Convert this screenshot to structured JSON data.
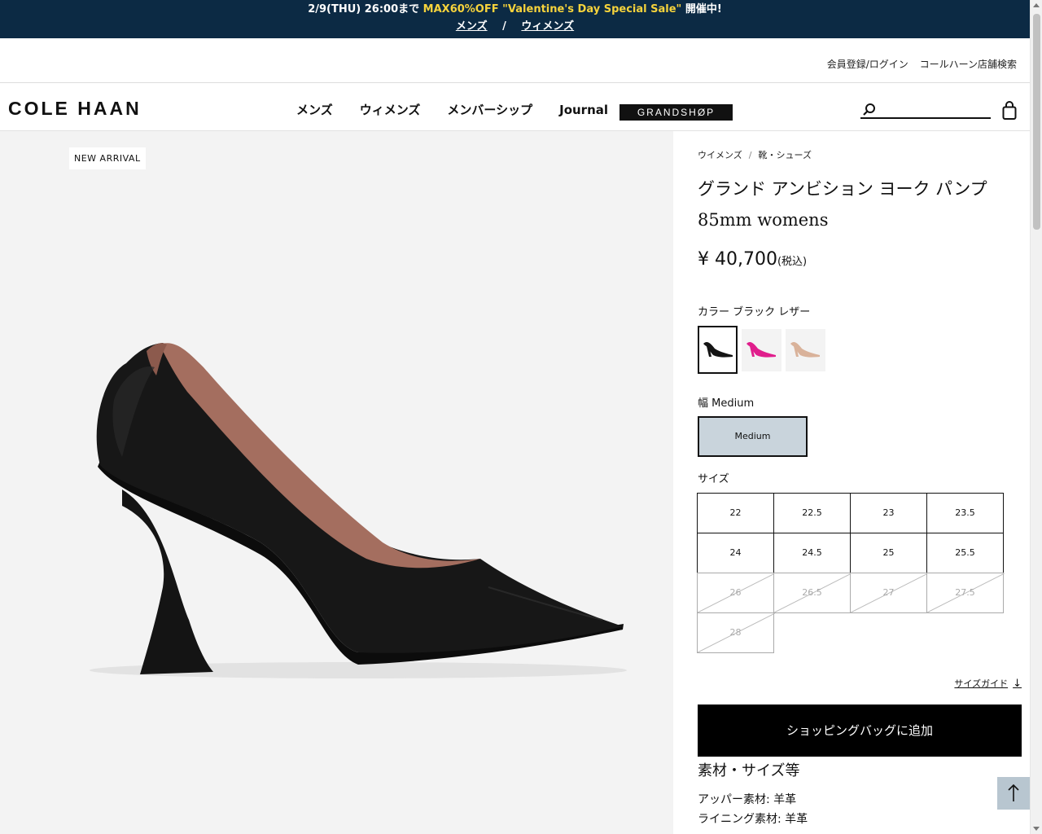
{
  "promo": {
    "prefix": "2/9(THU) 26:00まで ",
    "highlight": "MAX60%OFF \"Valentine's Day Special Sale\"",
    "suffix": " 開催中!",
    "links": [
      "メンズ",
      "ウィメンズ"
    ],
    "separator": "/"
  },
  "utility": {
    "login": "会員登録/ログイン",
    "store": "コールハーン店舗検索"
  },
  "header": {
    "logo": "COLE HAAN",
    "nav": [
      "メンズ",
      "ウィメンズ",
      "メンバーシップ",
      "Journal"
    ],
    "grandshop": "GRANDSHØP",
    "search_placeholder": ""
  },
  "image": {
    "badge": "NEW ARRIVAL",
    "colors": {
      "shoe": "#141414",
      "lining": "#a46e5f",
      "background": "#f3f3f3"
    }
  },
  "product": {
    "breadcrumb": [
      "ウイメンズ",
      "靴・シューズ"
    ],
    "title_line1": "グランド アンビション ヨーク パンプ",
    "title_line2": "85mm womens",
    "price": "¥ 40,700",
    "price_tax": "(税込)",
    "color_label": "カラー ブラック レザー",
    "swatches": [
      {
        "name": "black",
        "color": "#141414",
        "selected": true
      },
      {
        "name": "pink",
        "color": "#e01e8c",
        "selected": false
      },
      {
        "name": "nude",
        "color": "#d9b29a",
        "selected": false
      }
    ],
    "width_label": "幅 Medium",
    "width_option": "Medium",
    "size_label": "サイズ",
    "sizes": [
      {
        "label": "22",
        "available": true
      },
      {
        "label": "22.5",
        "available": true
      },
      {
        "label": "23",
        "available": true
      },
      {
        "label": "23.5",
        "available": true
      },
      {
        "label": "24",
        "available": true
      },
      {
        "label": "24.5",
        "available": true
      },
      {
        "label": "25",
        "available": true
      },
      {
        "label": "25.5",
        "available": true
      },
      {
        "label": "26",
        "available": false
      },
      {
        "label": "26.5",
        "available": false
      },
      {
        "label": "27",
        "available": false
      },
      {
        "label": "27.5",
        "available": false
      },
      {
        "label": "28",
        "available": false
      }
    ],
    "size_guide": "サイズガイド",
    "size_guide_arrow": "↓",
    "add_to_bag": "ショッピングバッグに追加",
    "spec_heading": "素材・サイズ等",
    "specs": [
      "アッパー素材: 羊革",
      "ライニング素材: 羊革"
    ],
    "back_to_top": "↑"
  }
}
